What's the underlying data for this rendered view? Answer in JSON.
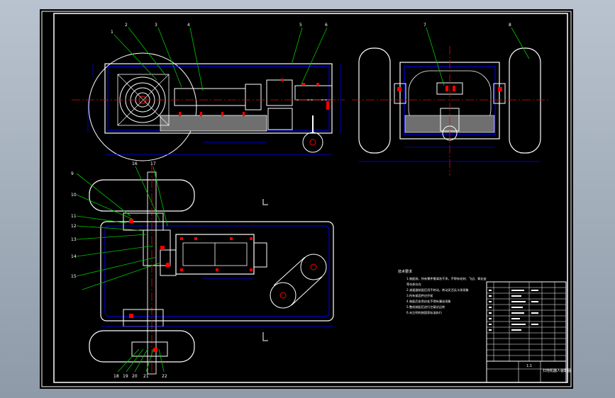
{
  "drawing": {
    "notes_title": "技术要求",
    "notes": [
      "1.装配前，所有零件需清洗干净，不得有毛刺、飞边、氧化皮",
      "  等杂质存在",
      "2.减速器装配后用手转动，转动灵活无卡滞现象",
      "3.所有紧固件应拧紧",
      "4.装配后各密封处不得有漏油现象",
      "5.整机装配后进行空载试运转",
      "6.未注明的按国家标准执行"
    ],
    "title_block": {
      "drawing_name": "扫地机器人装配图",
      "company": "",
      "scale": "1:1"
    },
    "part_numbers_top": [
      "1",
      "2",
      "3",
      "4",
      "5",
      "6",
      "7",
      "8"
    ],
    "part_numbers_left": [
      "9",
      "10",
      "11",
      "12",
      "13",
      "14",
      "15",
      "16",
      "17"
    ],
    "part_numbers_bottom": [
      "18",
      "19",
      "20",
      "21",
      "22"
    ],
    "colors": {
      "outline": "#ffffff",
      "body": "#0000ff",
      "center": "#ff0000",
      "leader": "#00c800",
      "fill": "#7f7f7f"
    }
  }
}
